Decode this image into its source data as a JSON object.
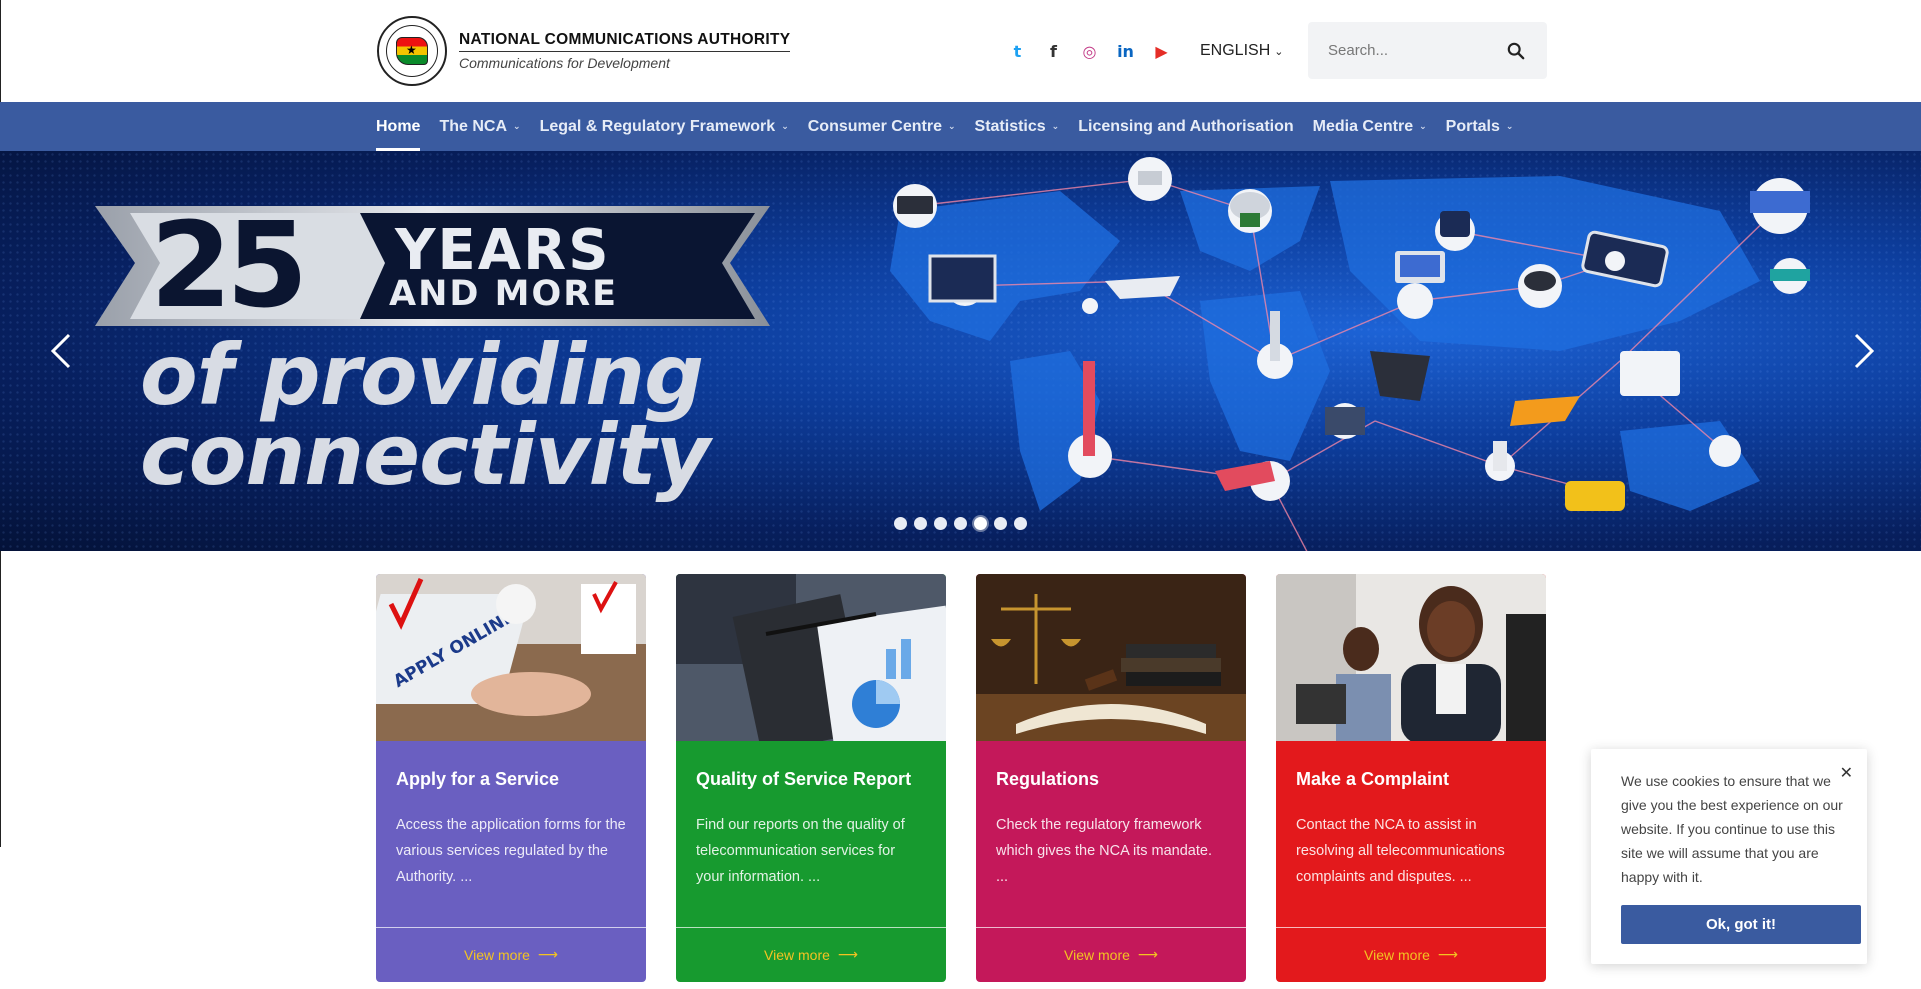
{
  "header": {
    "logo_title": "NATIONAL COMMUNICATIONS AUTHORITY",
    "logo_subtitle": "Communications for Development",
    "socials": [
      {
        "name": "twitter-icon",
        "glyph": "t",
        "color": "#1da1f2"
      },
      {
        "name": "facebook-icon",
        "glyph": "f",
        "color": "#333333"
      },
      {
        "name": "instagram-icon",
        "glyph": "◎",
        "color": "#c13584"
      },
      {
        "name": "linkedin-icon",
        "glyph": "in",
        "color": "#0a66c2"
      },
      {
        "name": "youtube-icon",
        "glyph": "▶",
        "color": "#e52d27"
      }
    ],
    "language": "ENGLISH",
    "search_placeholder": "Search..."
  },
  "nav": {
    "items": [
      {
        "label": "Home",
        "active": true,
        "dropdown": false
      },
      {
        "label": "The NCA",
        "active": false,
        "dropdown": true
      },
      {
        "label": "Legal & Regulatory Framework",
        "active": false,
        "dropdown": true
      },
      {
        "label": "Consumer Centre",
        "active": false,
        "dropdown": true
      },
      {
        "label": "Statistics",
        "active": false,
        "dropdown": true
      },
      {
        "label": "Licensing and Authorisation",
        "active": false,
        "dropdown": false
      },
      {
        "label": "Media Centre",
        "active": false,
        "dropdown": true
      },
      {
        "label": "Portals",
        "active": false,
        "dropdown": true
      }
    ]
  },
  "hero": {
    "number": "25",
    "years": "YEARS",
    "and_more": "AND MORE",
    "tagline_1": "of providing",
    "tagline_2": "connectivity",
    "slide_count": 7,
    "active_slide": 4
  },
  "cards": [
    {
      "title": "Apply for a Service",
      "text": "Access the application forms for the various services regulated by the Authority. ...",
      "link": "View more",
      "color": "#6a5fc1"
    },
    {
      "title": "Quality of Service Report",
      "text": "Find our reports on the quality of telecommunication services for your information. ...",
      "link": "View more",
      "color": "#179a2f"
    },
    {
      "title": "Regulations",
      "text": "Check the regulatory framework which gives the NCA its mandate. ...",
      "link": "View more",
      "color": "#c4185a"
    },
    {
      "title": "Make a Complaint",
      "text": "Contact the NCA to assist in resolving all telecommunications complaints and disputes. ...",
      "link": "View more",
      "color": "#e3191c"
    }
  ],
  "cookie": {
    "message": "We use cookies to ensure that we give you the best experience on our website. If you continue to use this site we will assume that you are happy with it.",
    "button": "Ok, got it!"
  }
}
